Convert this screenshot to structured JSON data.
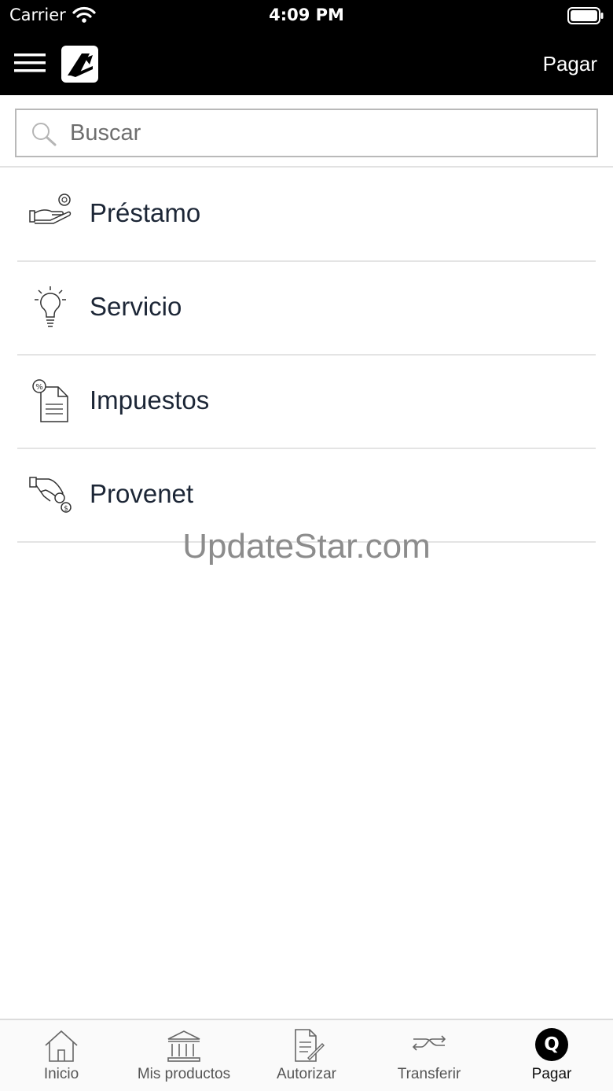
{
  "status_bar": {
    "carrier": "Carrier",
    "time": "4:09 PM"
  },
  "nav": {
    "title": "Pagar"
  },
  "search": {
    "placeholder": "Buscar"
  },
  "items": [
    {
      "label": "Préstamo",
      "icon": "hand-coin-icon"
    },
    {
      "label": "Servicio",
      "icon": "lightbulb-icon"
    },
    {
      "label": "Impuestos",
      "icon": "tax-document-icon"
    },
    {
      "label": "Provenet",
      "icon": "hand-coins-icon"
    }
  ],
  "watermark": "UpdateStar.com",
  "tabs": [
    {
      "label": "Inicio",
      "icon": "home-icon"
    },
    {
      "label": "Mis productos",
      "icon": "bank-icon"
    },
    {
      "label": "Autorizar",
      "icon": "document-sign-icon"
    },
    {
      "label": "Transferir",
      "icon": "transfer-arrows-icon"
    },
    {
      "label": "Pagar",
      "icon": "pay-q-icon",
      "glyph": "Q",
      "active": true
    }
  ]
}
